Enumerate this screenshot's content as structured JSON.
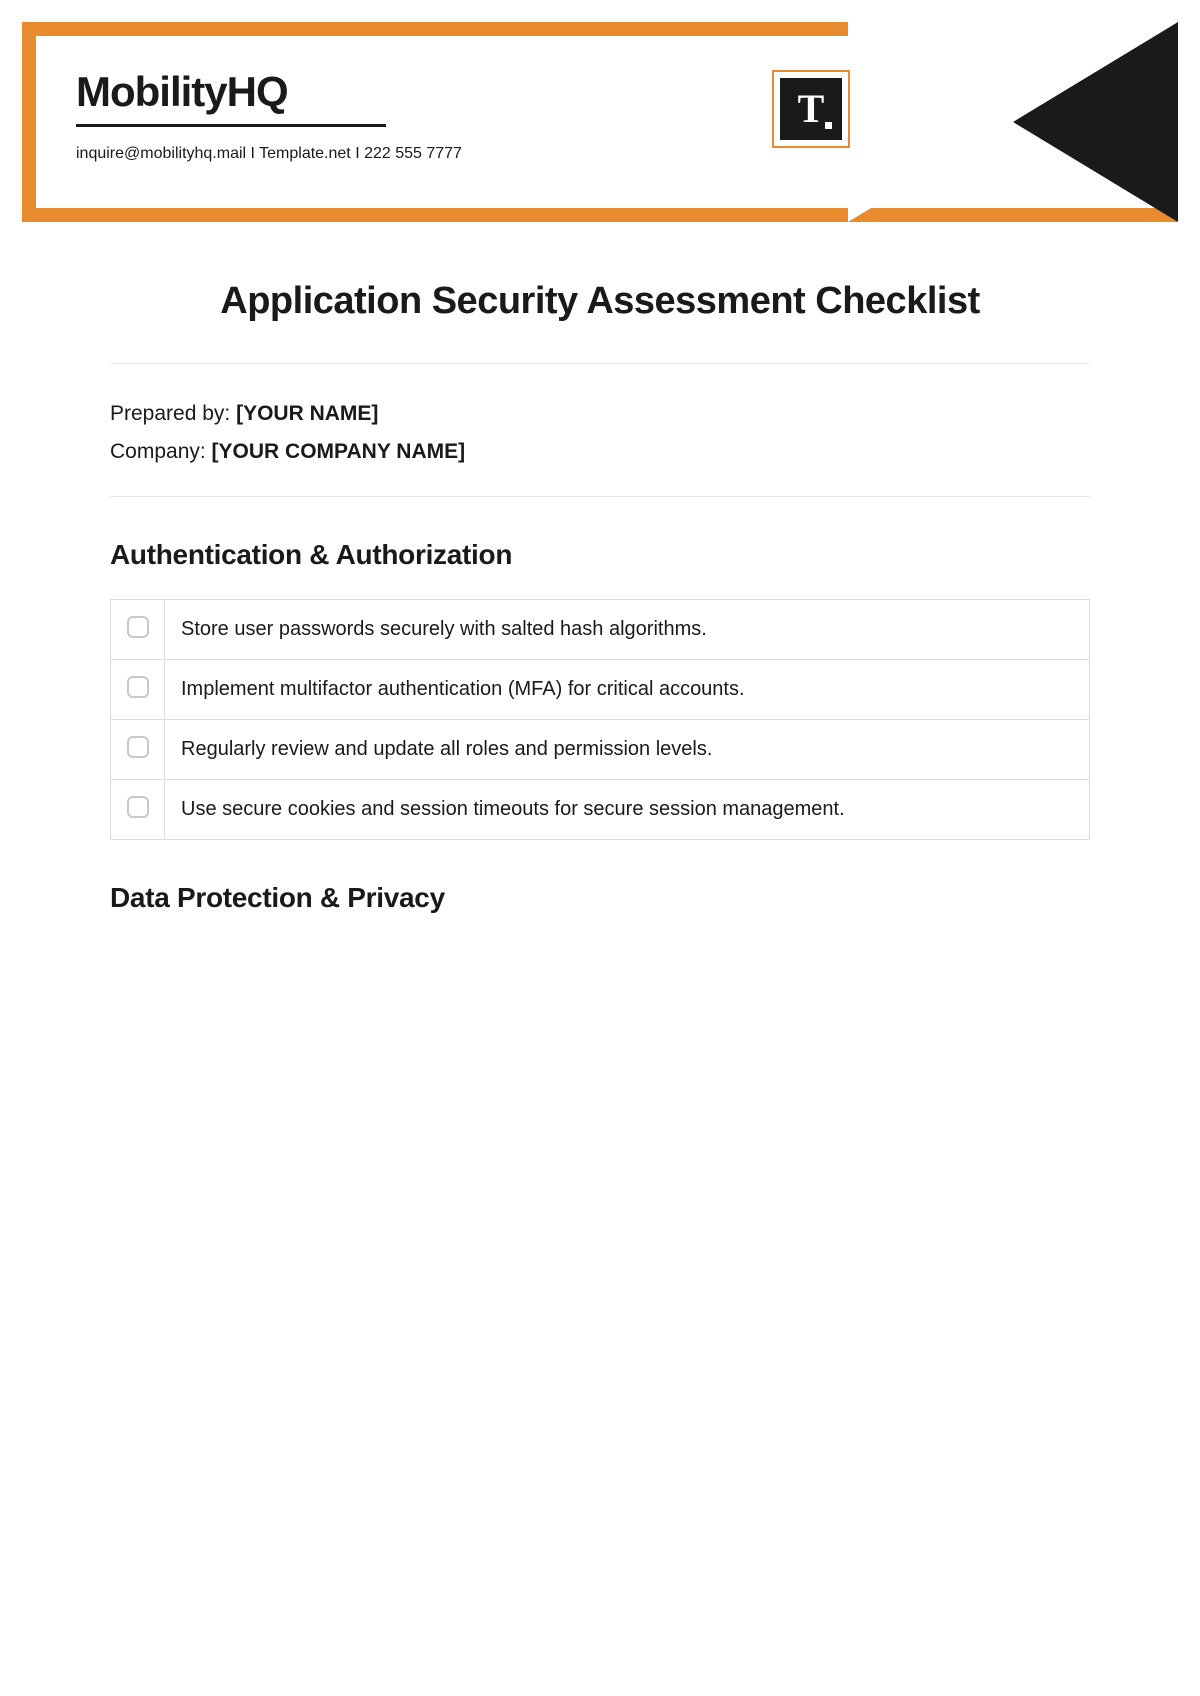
{
  "header": {
    "brand": "MobilityHQ",
    "contact": "inquire@mobilityhq.mail  I  Template.net  I  222 555 7777",
    "logo_letter": "T"
  },
  "title": "Application Security Assessment Checklist",
  "meta": {
    "prepared_label": "Prepared by: ",
    "prepared_value": "[YOUR NAME]",
    "company_label": "Company: ",
    "company_value": "[YOUR COMPANY NAME]"
  },
  "sections": [
    {
      "heading": "Authentication & Authorization",
      "items": [
        "Store user passwords securely with salted hash algorithms.",
        "Implement multifactor authentication (MFA) for critical accounts.",
        "Regularly review and update all roles and permission levels.",
        "Use secure cookies and session timeouts for secure session management."
      ]
    },
    {
      "heading": "Data Protection & Privacy",
      "items": []
    }
  ],
  "colors": {
    "accent": "#e88b2e",
    "text": "#1a1a1a",
    "border_light": "#eaeaea",
    "table_border": "#dcdcdc"
  }
}
